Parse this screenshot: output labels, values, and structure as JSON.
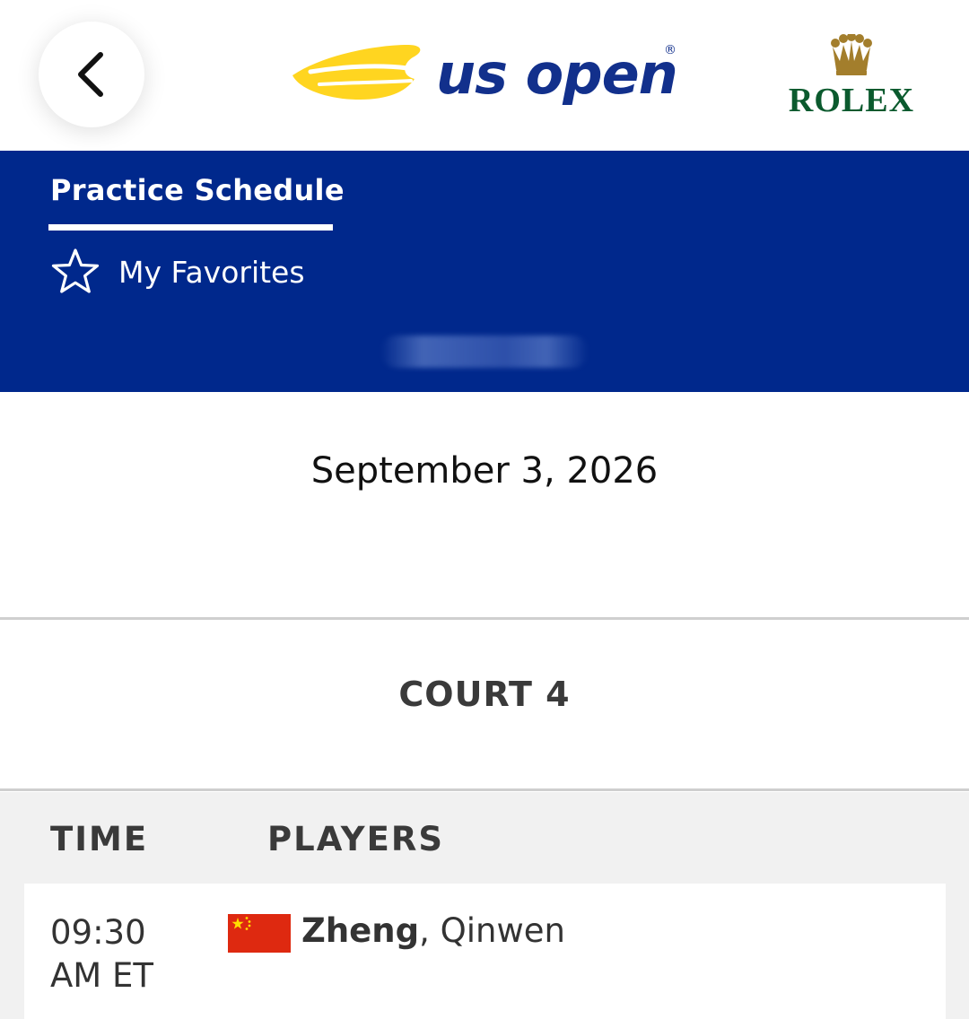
{
  "header": {
    "back_icon": "chevron-left-icon",
    "brand_logo_text": "us open",
    "sponsor_logo_text": "ROLEX"
  },
  "tabs": {
    "practice_schedule": "Practice Schedule",
    "my_favorites": "My Favorites",
    "favorites_icon": "star-outline-icon"
  },
  "schedule": {
    "date": "September 3, 2026",
    "court": "COURT 4",
    "columns": {
      "time": "TIME",
      "players": "PLAYERS"
    },
    "rows": [
      {
        "time_line1": "09:30",
        "time_line2": "AM ET",
        "flag": "china-flag-icon",
        "last_name": "Zheng",
        "first_name": ", Qinwen"
      }
    ]
  },
  "colors": {
    "band_blue": "#00288c",
    "logo_navy": "#12308c",
    "logo_yellow": "#ffd520",
    "rolex_green": "#0b5a2e",
    "rolex_gold": "#a37e2c"
  }
}
